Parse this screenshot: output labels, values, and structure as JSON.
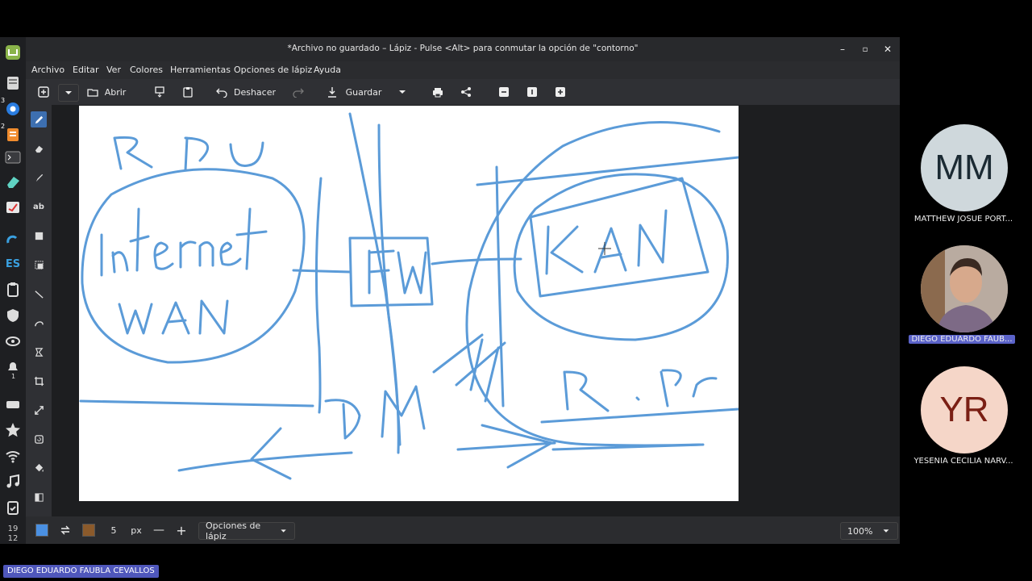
{
  "window": {
    "title": "*Archivo no guardado – Lápiz - Pulse <Alt> para conmutar la opción de \"contorno\""
  },
  "menu": [
    "Archivo",
    "Editar",
    "Ver",
    "Colores",
    "Herramientas",
    "Opciones de lápiz",
    "Ayuda"
  ],
  "toolbar": {
    "open_label": "Abrir",
    "undo_label": "Deshacer",
    "save_label": "Guardar"
  },
  "tools": [
    "pencil-icon",
    "eraser-icon",
    "brush-icon",
    "text-icon",
    "rectangle-icon",
    "selection-icon",
    "line-icon",
    "curve-icon",
    "freeform-shape-icon",
    "crop-icon",
    "scale-icon",
    "rotate-icon",
    "fill-icon",
    "highlight-icon"
  ],
  "bottombar": {
    "main_color": "#4a90e2",
    "secondary_color": "#8b5a2b",
    "size_value": "5",
    "size_unit": "px",
    "options_label": "Opciones de lápiz",
    "zoom": "100%"
  },
  "system": {
    "clock_hour": "19",
    "clock_min": "12",
    "badge_count": "3",
    "badge_count_2": "2",
    "lang": "ES",
    "tray_num": "1"
  },
  "drawing_text": [
    "R P U",
    "Internet",
    "WAN",
    "FW",
    "DM",
    "KAN",
    "R. Pr"
  ],
  "participants": [
    {
      "initials": "MM",
      "name": "MATTHEW JOSUE PORT...",
      "color": "#cfd8dc",
      "text_color": "#1b2a33"
    },
    {
      "initials": "",
      "name": "DIEGO EDUARDO FAUB...",
      "color": "#9c8f86",
      "text_color": "#fff"
    },
    {
      "initials": "YR",
      "name": "YESENIA CECILIA NARV...",
      "color": "#f5d6c8",
      "text_color": "#7a1f14"
    }
  ],
  "speaker_label": "DIEGO EDUARDO FAUBLA CEVALLOS"
}
